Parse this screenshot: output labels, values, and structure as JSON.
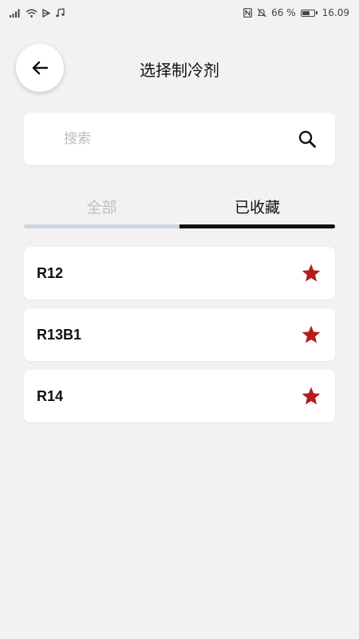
{
  "status_bar": {
    "battery_percent": "66 %",
    "battery_level": 0.66,
    "time": "16.09",
    "icons": [
      "signal-icon",
      "wifi-icon",
      "media-icon",
      "music-note-icon",
      "nfc-icon",
      "mute-icon",
      "battery-icon"
    ]
  },
  "header": {
    "title": "选择制冷剂",
    "back_icon": "arrow-left-icon"
  },
  "search": {
    "placeholder": "搜索",
    "value": "",
    "icon": "search-icon"
  },
  "tabs": [
    {
      "label": "全部",
      "active": false
    },
    {
      "label": "已收藏",
      "active": true
    }
  ],
  "favorites": [
    {
      "label": "R12",
      "starred": true
    },
    {
      "label": "R13B1",
      "starred": true
    },
    {
      "label": "R14",
      "starred": true
    }
  ],
  "colors": {
    "background": "#f2f2f2",
    "card": "#ffffff",
    "star": "#b71c1c",
    "inactive_tab": "#bdbdbd",
    "track": "#cdd5de",
    "indicator": "#111111"
  }
}
